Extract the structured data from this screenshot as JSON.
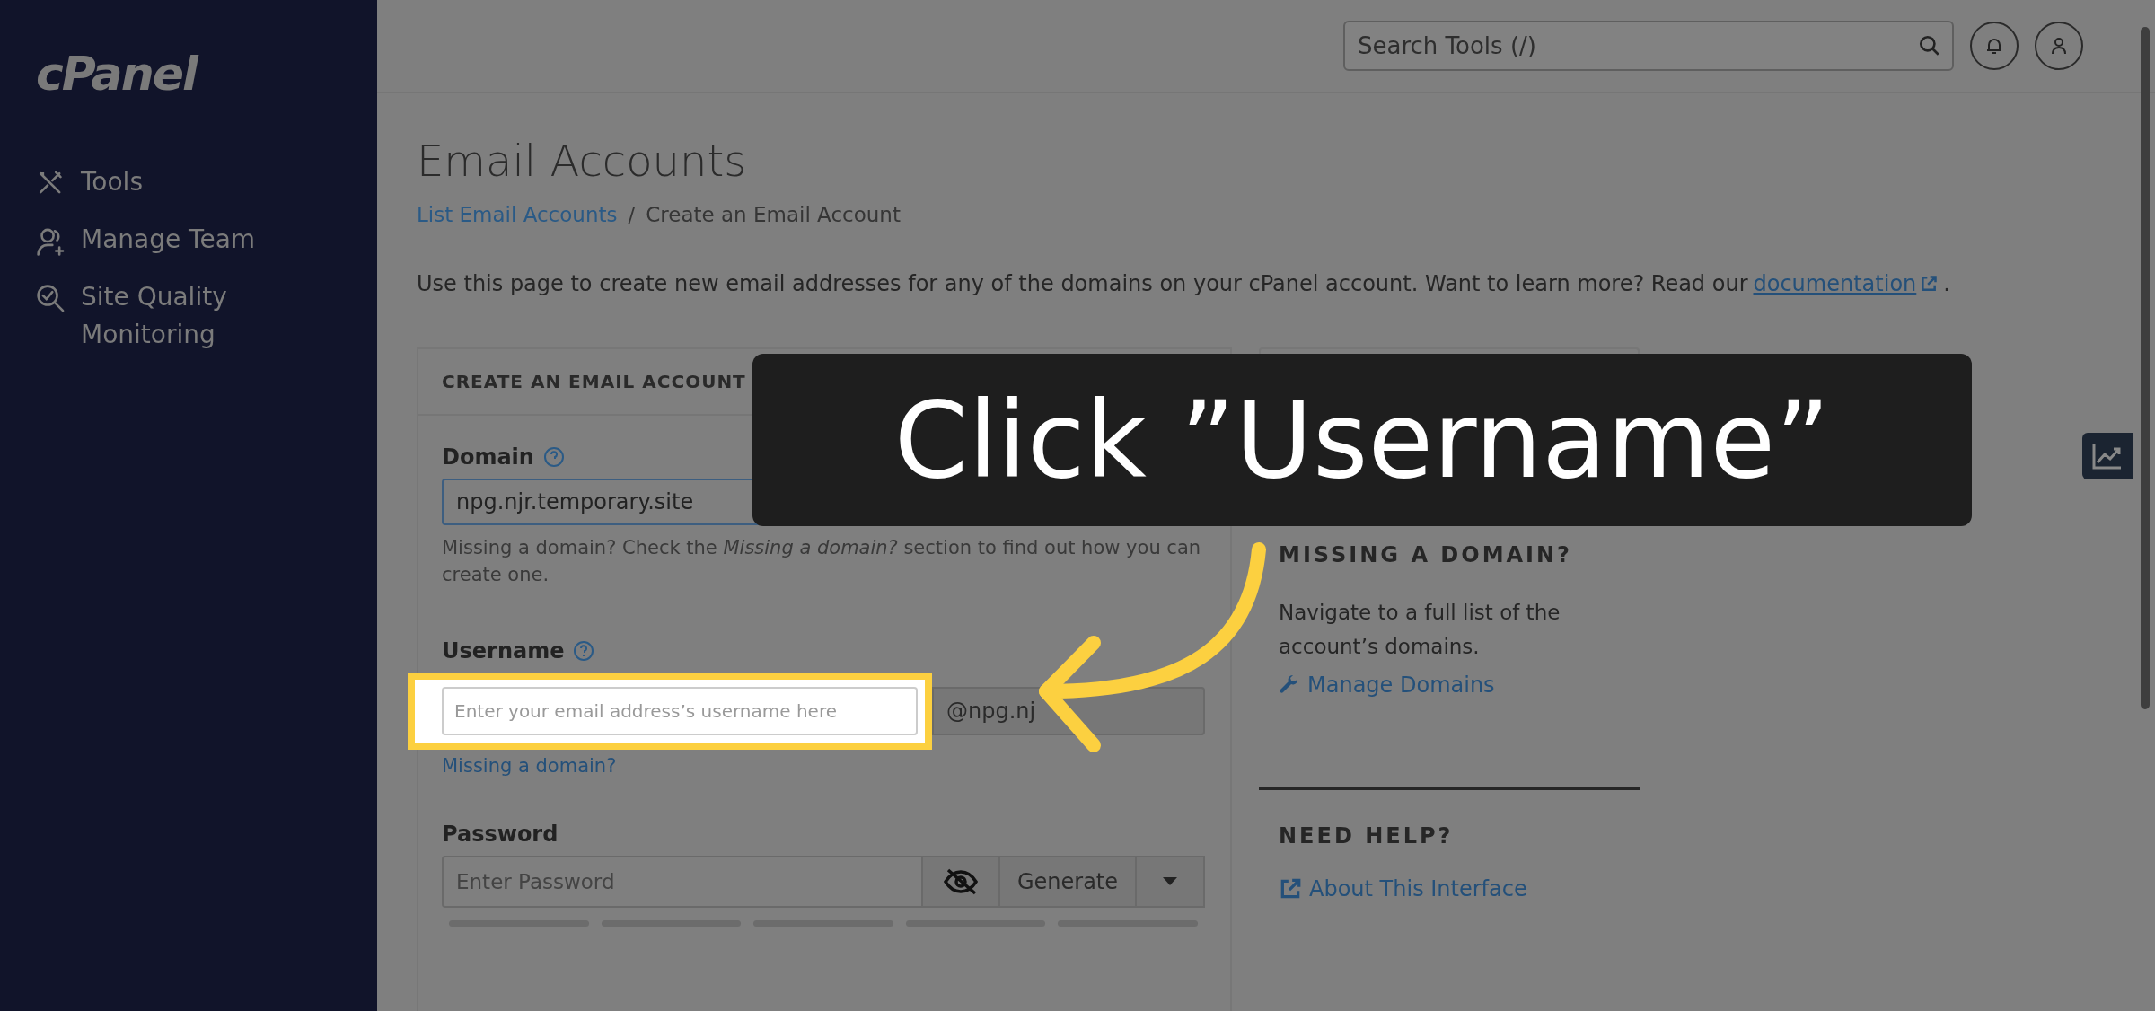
{
  "sidebar": {
    "logo": "cPanel",
    "items": [
      {
        "label": "Tools"
      },
      {
        "label": "Manage Team"
      },
      {
        "label": "Site Quality Monitoring"
      }
    ]
  },
  "header": {
    "search": {
      "placeholder": "Search Tools (/)"
    }
  },
  "page": {
    "title": "Email Accounts",
    "breadcrumb": [
      {
        "label": "List Email Accounts",
        "link": true
      },
      {
        "label": "Create an Email Account",
        "link": false
      }
    ],
    "breadcrumb_separator": "/",
    "description": {
      "text": "Use this page to create new email addresses for any of the domains on your cPanel account. Want to learn more? Read our",
      "link": "documentation",
      "end": "."
    }
  },
  "form": {
    "title": "CREATE AN EMAIL ACCOUNT",
    "domain": {
      "label": "Domain",
      "value": "npg.njr.temporary.site",
      "hint": "Missing a domain? Check the *Missing a domain?* section to find out how you can create one."
    },
    "username": {
      "label": "Username",
      "placeholder": "Enter your email address’s username here",
      "suffix": "@npg.nj",
      "link": "Missing a domain?"
    },
    "password": {
      "label": "Password",
      "placeholder": "Enter Password",
      "generate": "Generate"
    }
  },
  "side": {
    "missing": {
      "title": "MISSING A DOMAIN?",
      "text": "Navigate to a full list of the account’s domains.",
      "link": "Manage Domains"
    },
    "help": {
      "title": "NEED HELP?",
      "link": "About This Interface"
    }
  },
  "callout": {
    "text": "Click ”Username”"
  }
}
